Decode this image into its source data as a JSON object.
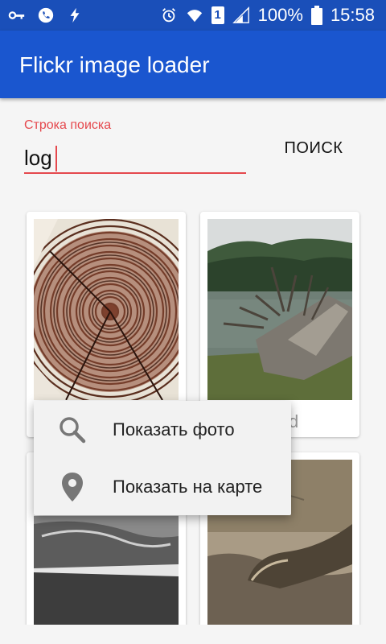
{
  "status_bar": {
    "battery_percent": "100%",
    "time": "15:58",
    "sim_label": "1",
    "icons": [
      "key-icon",
      "phone-icon",
      "bolt-icon",
      "alarm-icon",
      "wifi-icon",
      "sim-icon",
      "signal-icon",
      "battery-icon"
    ]
  },
  "app_bar": {
    "title": "Flickr image loader"
  },
  "search": {
    "label": "Строка поиска",
    "value": "log",
    "button_label": "ПОИСК"
  },
  "grid": {
    "cards": [
      {
        "caption": ""
      },
      {
        "caption": "d"
      },
      {
        "caption": ""
      },
      {
        "caption": ""
      }
    ]
  },
  "context_menu": {
    "items": [
      {
        "label": "Показать фото",
        "icon": "search-icon"
      },
      {
        "label": "Показать на карте",
        "icon": "map-pin-icon"
      }
    ]
  },
  "colors": {
    "accent": "#e5484d",
    "primary": "#1a56cf",
    "status": "#1a4fb9"
  }
}
